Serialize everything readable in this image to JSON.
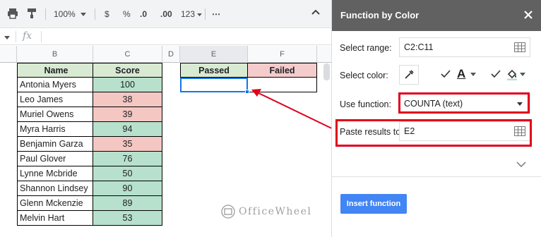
{
  "toolbar": {
    "zoom": "100%",
    "currency": "$",
    "percent": "%",
    "decrease_decimals": ".0",
    "increase_decimals": ".00",
    "number_format": "123",
    "more": "⋯"
  },
  "formula_bar": {
    "fx": "fx",
    "value": ""
  },
  "sheet": {
    "columns": [
      "B",
      "C",
      "D",
      "E",
      "F"
    ],
    "header_row": {
      "name": "Name",
      "score": "Score",
      "passed": "Passed",
      "failed": "Failed"
    },
    "rows": [
      {
        "name": "Antonia Myers",
        "score": "100",
        "status": "pass"
      },
      {
        "name": "Leo James",
        "score": "38",
        "status": "fail"
      },
      {
        "name": "Muriel Owens",
        "score": "39",
        "status": "fail"
      },
      {
        "name": "Myra Harris",
        "score": "94",
        "status": "pass"
      },
      {
        "name": "Benjamin Garza",
        "score": "35",
        "status": "fail"
      },
      {
        "name": "Paul Glover",
        "score": "76",
        "status": "pass"
      },
      {
        "name": "Lynne Mcbride",
        "score": "50",
        "status": "pass"
      },
      {
        "name": "Shannon Lindsey",
        "score": "90",
        "status": "pass"
      },
      {
        "name": "Glenn Mckenzie",
        "score": "89",
        "status": "pass"
      },
      {
        "name": "Melvin Hart",
        "score": "53",
        "status": "pass"
      }
    ]
  },
  "watermark": "OfficeWheel",
  "panel": {
    "title": "Function by Color",
    "select_range_label": "Select range:",
    "select_range_value": "C2:C11",
    "select_color_label": "Select color:",
    "font_color_glyph": "A",
    "use_function_label": "Use function:",
    "use_function_value": "COUNTA (text)",
    "paste_results_label": "Paste results to:",
    "paste_results_value": "E2",
    "insert_button": "Insert function"
  },
  "colors": {
    "header_panel": "#616161",
    "pass_fill": "#b7e1cd",
    "fail_fill": "#f4c7c3",
    "highlight_red": "#e0001b",
    "accent_blue": "#4285f4",
    "selection_blue": "#1a73e8"
  },
  "icons": [
    "print-icon",
    "paint-format-icon",
    "chevron-down-icon",
    "more-icon",
    "chevron-up-icon",
    "grid-range-icon",
    "eyedropper-icon",
    "checkbox-icon",
    "font-color-icon",
    "fill-color-icon",
    "close-icon",
    "expand-icon",
    "arrow-icon",
    "watermark-logo-icon"
  ]
}
